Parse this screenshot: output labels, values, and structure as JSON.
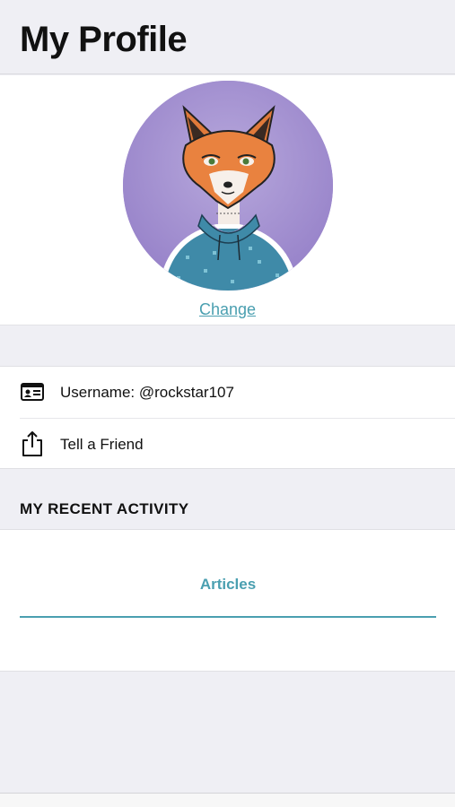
{
  "header": {
    "title": "My Profile"
  },
  "profile": {
    "change_label": "Change"
  },
  "list": {
    "items": [
      {
        "label": "Username: @rockstar107",
        "icon": "id-card-icon"
      },
      {
        "label": "Tell a Friend",
        "icon": "share-icon"
      }
    ]
  },
  "activity": {
    "heading": "MY RECENT ACTIVITY",
    "tabs": [
      {
        "label": "Articles",
        "active": true
      }
    ]
  },
  "colors": {
    "accent": "#4a9fb0",
    "background": "#efeff4",
    "avatar_bg": "#a28fcf"
  }
}
